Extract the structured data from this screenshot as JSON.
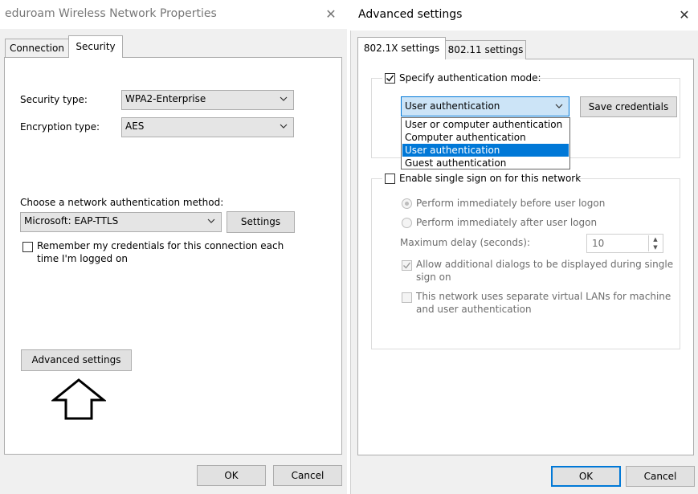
{
  "left_dialog": {
    "title": "eduroam Wireless Network Properties",
    "close": "✕",
    "tabs": [
      "Connection",
      "Security"
    ],
    "security_type_label": "Security type:",
    "security_type_value": "WPA2-Enterprise",
    "encryption_type_label": "Encryption type:",
    "encryption_type_value": "AES",
    "auth_method_label": "Choose a network authentication method:",
    "auth_method_value": "Microsoft: EAP-TTLS",
    "settings_button": "Settings",
    "remember_label_line1": "Remember my credentials for this connection each",
    "remember_label_line2": "time I'm logged on",
    "advanced_button": "Advanced settings",
    "ok_button": "OK",
    "cancel_button": "Cancel"
  },
  "right_dialog": {
    "title": "Advanced settings",
    "close": "✕",
    "tabs": [
      "802.1X settings",
      "802.11 settings"
    ],
    "specify_auth_label": "Specify authentication mode:",
    "auth_mode_value": "User authentication",
    "auth_mode_options": [
      "User or computer authentication",
      "Computer authentication",
      "User authentication",
      "Guest authentication"
    ],
    "save_credentials_button": "Save credentials",
    "sso_label": "Enable single sign on for this network",
    "radio_before_logon": "Perform immediately before user logon",
    "radio_after_logon": "Perform immediately after user logon",
    "max_delay_label": "Maximum delay (seconds):",
    "max_delay_value": "10",
    "allow_dialogs_line1": "Allow additional dialogs to be displayed during single",
    "allow_dialogs_line2": "sign on",
    "vlan_line1": "This network uses separate virtual LANs for machine",
    "vlan_line2": "and user authentication",
    "ok_button": "OK",
    "cancel_button": "Cancel"
  }
}
